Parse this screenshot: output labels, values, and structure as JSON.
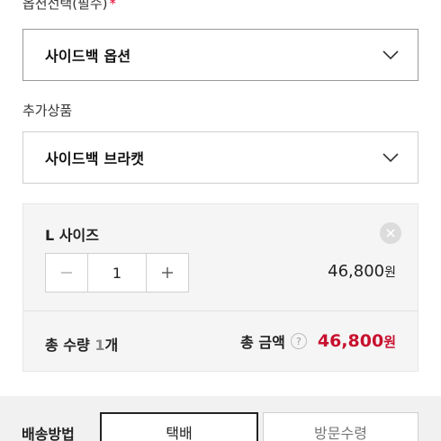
{
  "option": {
    "label": "옵션선택(필수)",
    "required_mark": "*",
    "selected": "사이드백 옵션"
  },
  "addon": {
    "label": "추가상품",
    "selected": "사이드백 브라캣"
  },
  "summary": {
    "item_name": "L 사이즈",
    "quantity": "1",
    "item_price": "46,800",
    "item_price_unit": "원",
    "total_qty_label": "총 수량",
    "total_qty_value": "1",
    "total_qty_unit": "개",
    "total_amount_label": "총 금액",
    "help_glyph": "?",
    "total_amount": "46,800",
    "total_amount_unit": "원"
  },
  "shipping": {
    "label": "배송방법",
    "options": [
      "택배",
      "방문수령"
    ]
  },
  "icons": {
    "dropdown": "chevron-down-icon",
    "remove": "close-icon",
    "minus": "minus-icon",
    "plus": "plus-icon",
    "help": "question-icon"
  },
  "colors": {
    "accent_price": "#c8102e",
    "required": "#e4002b"
  }
}
